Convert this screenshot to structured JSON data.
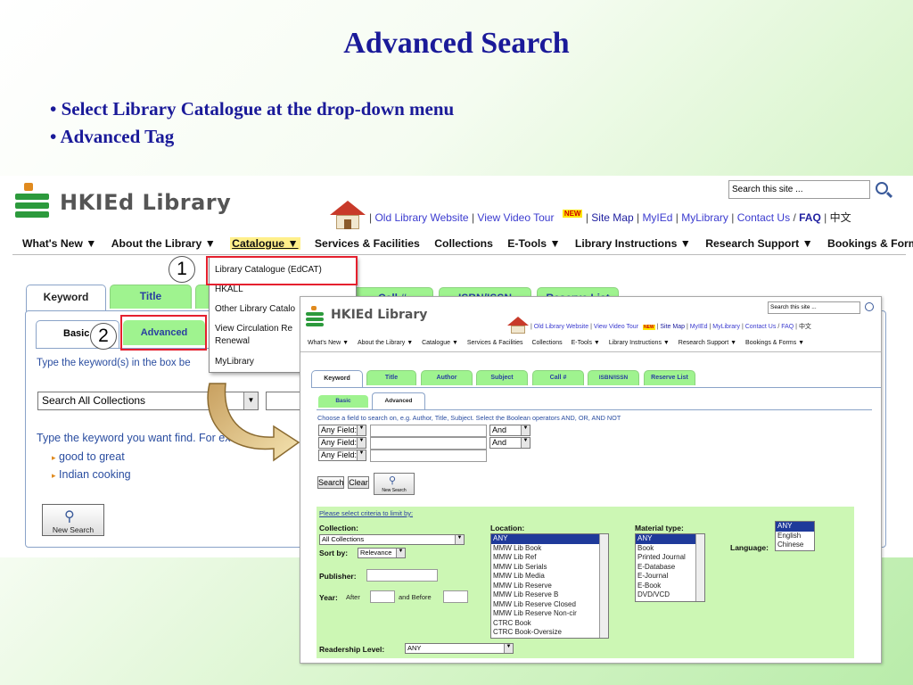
{
  "slide": {
    "title": "Advanced Search",
    "bullets": [
      "• Select Library Catalogue at the drop-down menu",
      "• Advanced Tag"
    ],
    "callouts": [
      "1",
      "2"
    ]
  },
  "site": {
    "logo_text": "HKIEd Library",
    "search_placeholder": "Search this site ...",
    "toplinks": {
      "old_site": "Old Library Website",
      "video_tour": "View Video Tour",
      "new_badge": "NEW",
      "site_map": "Site Map",
      "myied": "MyIEd",
      "mylibrary": "MyLibrary",
      "contact": "Contact Us",
      "slash": "/",
      "faq": "FAQ",
      "chinese": "中文"
    },
    "menu": [
      "What's New ▼",
      "About the Library ▼",
      "Catalogue ▼",
      "Services & Facilities",
      "Collections",
      "E-Tools ▼",
      "Library Instructions ▼",
      "Research Support ▼",
      "Bookings & Forms ▼"
    ],
    "colors": {
      "tab_green": "#9ff38f",
      "link_blue": "#3b3bcf",
      "highlight_red": "#e5202e",
      "limit_bg": "#ccf7b4"
    }
  },
  "shot1": {
    "tabs": [
      "Keyword",
      "Title",
      "",
      "",
      "Call #",
      "ISBN/ISSN",
      "Reserve List"
    ],
    "subtabs": [
      "Basic",
      "Advanced"
    ],
    "dropdown": [
      "Library Catalogue (EdCAT)",
      "HKALL",
      "Other Library Catalo",
      "View Circulation Re",
      "Renewal",
      "MyLibrary"
    ],
    "instruction": "Type the keyword(s) in the box be",
    "collection_select": "Search All Collections",
    "example_intro": "Type the keyword you want   find. For exa",
    "examples": [
      "good to great",
      "Indian cooking"
    ],
    "new_search": "New Search"
  },
  "shot2": {
    "menu": [
      "What's New ▼",
      "About the Library ▼",
      "Catalogue ▼",
      "Services & Facilities",
      "Collections",
      "E-Tools ▼",
      "Library Instructions ▼",
      "Research Support ▼",
      "Bookings & Forms ▼"
    ],
    "tabs": [
      "Keyword",
      "Title",
      "Author",
      "Subject",
      "Call #",
      "ISBN/ISSN",
      "Reserve List"
    ],
    "subtabs": [
      "Basic",
      "Advanced"
    ],
    "instruction": "Choose a field to search on, e.g. Author, Title, Subject. Select the Boolean operators AND, OR, AND NOT",
    "field_select": "Any Field:",
    "bool_select": "And",
    "buttons": {
      "search": "Search",
      "clear": "Clear",
      "new_search": "New Search"
    },
    "limit_link": "Please select criteria to limit by:",
    "collection_label": "Collection:",
    "collection_value": "All Collections",
    "sortby_label": "Sort by:",
    "sortby_value": "Relevance",
    "publisher_label": "Publisher:",
    "year_label": "Year:",
    "after_label": "After",
    "before_label": "and Before",
    "location_label": "Location:",
    "locations": [
      "ANY",
      "MMW Lib Book",
      "MMW Lib Ref",
      "MMW Lib Serials",
      "MMW Lib Media",
      "MMW Lib Reserve",
      "MMW Lib Reserve B",
      "MMW Lib Reserve Closed",
      "MMW Lib Reserve Non-cir",
      "CTRC Book",
      "CTRC Book-Oversize"
    ],
    "material_label": "Material type:",
    "materials": [
      "ANY",
      "Book",
      "Printed Journal",
      "E-Database",
      "E-Journal",
      "E-Book",
      "DVD/VCD"
    ],
    "language_label": "Language:",
    "languages": [
      "ANY",
      "English",
      "Chinese"
    ],
    "readership_label": "Readership Level:",
    "readership_value": "ANY"
  }
}
